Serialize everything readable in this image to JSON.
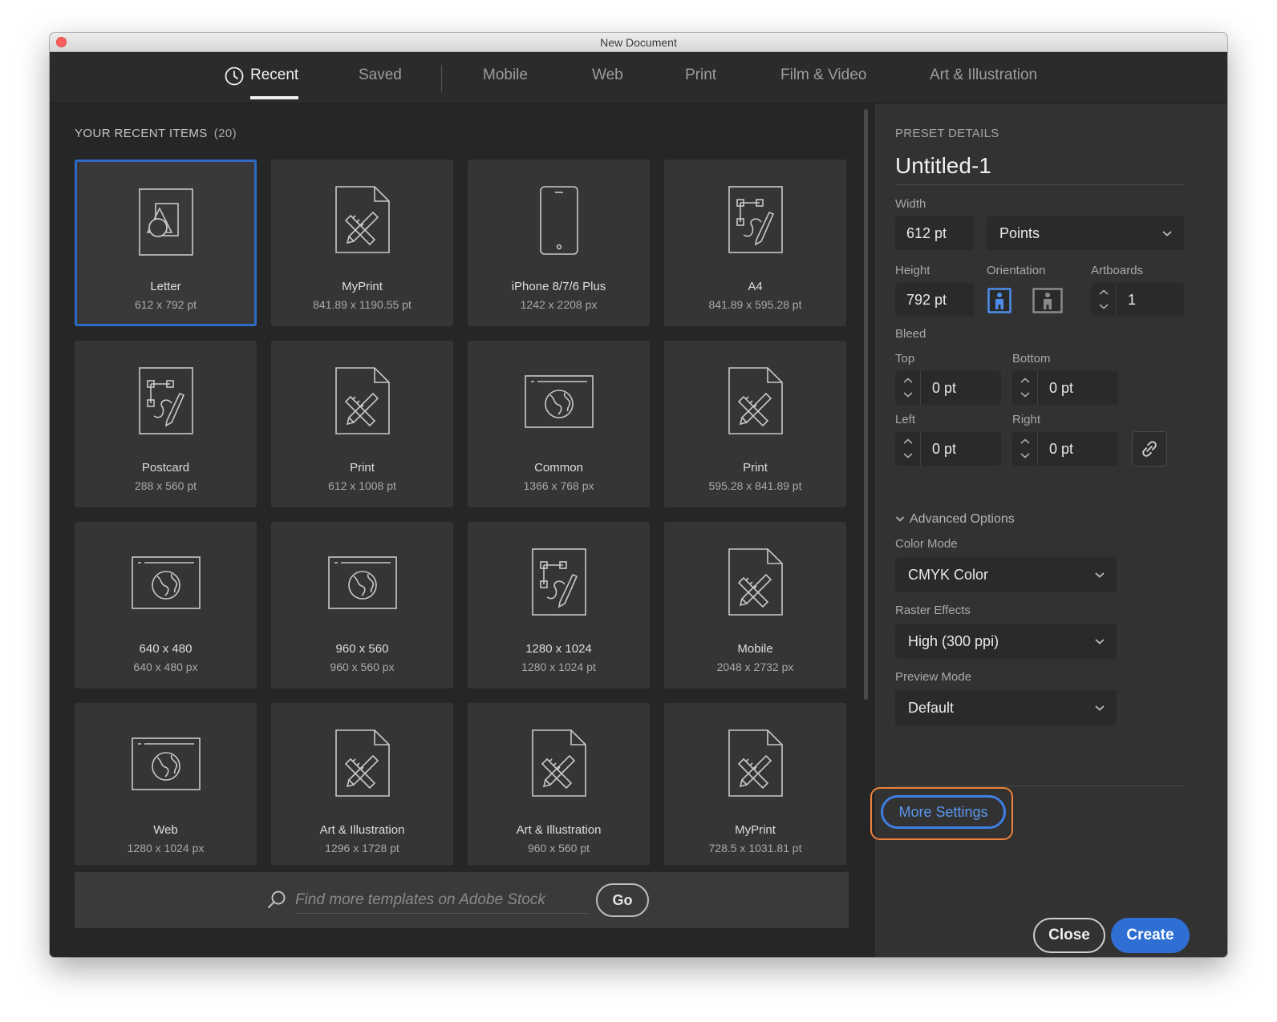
{
  "window": {
    "title": "New Document"
  },
  "tabs": [
    {
      "label": "Recent",
      "active": true,
      "icon": "clock-icon"
    },
    {
      "label": "Saved"
    },
    {
      "label": "Mobile"
    },
    {
      "label": "Web"
    },
    {
      "label": "Print"
    },
    {
      "label": "Film & Video"
    },
    {
      "label": "Art & Illustration"
    }
  ],
  "recent": {
    "header": "YOUR RECENT ITEMS",
    "count": "(20)",
    "items": [
      {
        "name": "Letter",
        "size": "612 x 792 pt",
        "icon": "shapes-doc-icon",
        "selected": true
      },
      {
        "name": "MyPrint",
        "size": "841.89 x 1190.55 pt",
        "icon": "print-doc-icon"
      },
      {
        "name": "iPhone 8/7/6 Plus",
        "size": "1242 x 2208 px",
        "icon": "phone-icon"
      },
      {
        "name": "A4",
        "size": "841.89 x 595.28 pt",
        "icon": "art-doc-icon"
      },
      {
        "name": "Postcard",
        "size": "288 x 560 pt",
        "icon": "art-doc-icon"
      },
      {
        "name": "Print",
        "size": "612 x 1008 pt",
        "icon": "print-doc-icon"
      },
      {
        "name": "Common",
        "size": "1366 x 768 px",
        "icon": "web-globe-icon"
      },
      {
        "name": "Print",
        "size": "595.28 x 841.89 pt",
        "icon": "print-doc-icon"
      },
      {
        "name": "640 x 480",
        "size": "640 x 480 px",
        "icon": "web-globe-icon"
      },
      {
        "name": "960 x 560",
        "size": "960 x 560 px",
        "icon": "web-globe-icon"
      },
      {
        "name": "1280 x 1024",
        "size": "1280 x 1024 pt",
        "icon": "art-doc-icon"
      },
      {
        "name": "Mobile",
        "size": "2048 x 2732 px",
        "icon": "print-doc-icon"
      },
      {
        "name": "Web",
        "size": "1280 x 1024 px",
        "icon": "web-globe-icon"
      },
      {
        "name": "Art & Illustration",
        "size": "1296 x 1728 pt",
        "icon": "print-doc-icon"
      },
      {
        "name": "Art & Illustration",
        "size": "960 x 560 pt",
        "icon": "print-doc-icon"
      },
      {
        "name": "MyPrint",
        "size": "728.5 x 1031.81 pt",
        "icon": "print-doc-icon"
      }
    ]
  },
  "search": {
    "placeholder": "Find more templates on Adobe Stock",
    "go_label": "Go"
  },
  "preset": {
    "section_label": "PRESET DETAILS",
    "doc_name": "Untitled-1",
    "width_label": "Width",
    "width_value": "612 pt",
    "units": "Points",
    "height_label": "Height",
    "height_value": "792 pt",
    "orientation_label": "Orientation",
    "orientation": "portrait",
    "artboards_label": "Artboards",
    "artboards_value": "1",
    "bleed_label": "Bleed",
    "bleed": {
      "top_label": "Top",
      "top": "0 pt",
      "bottom_label": "Bottom",
      "bottom": "0 pt",
      "left_label": "Left",
      "left": "0 pt",
      "right_label": "Right",
      "right": "0 pt"
    },
    "advanced_label": "Advanced Options",
    "color_mode_label": "Color Mode",
    "color_mode": "CMYK Color",
    "raster_label": "Raster Effects",
    "raster": "High (300 ppi)",
    "preview_label": "Preview Mode",
    "preview": "Default"
  },
  "actions": {
    "more_settings": "More Settings",
    "close": "Close",
    "create": "Create"
  },
  "colors": {
    "accent": "#2f6fd4",
    "highlight": "#f1813a",
    "panel": "#323232",
    "grid_bg": "#262626"
  }
}
